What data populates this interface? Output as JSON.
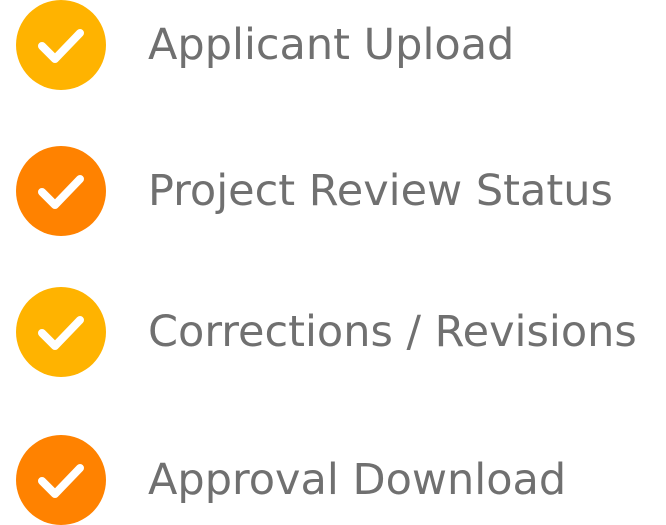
{
  "features": [
    {
      "label": "Applicant Upload",
      "icon": "check-circle-icon",
      "color": "#FFB300"
    },
    {
      "label": "Project Review Status",
      "icon": "check-circle-icon",
      "color": "#FF8200"
    },
    {
      "label": "Corrections / Revisions",
      "icon": "check-circle-icon",
      "color": "#FFB300"
    },
    {
      "label": "Approval Download",
      "icon": "check-circle-icon",
      "color": "#FF8200"
    }
  ],
  "text_color": "#707070",
  "check_color": "#FFFFFF"
}
